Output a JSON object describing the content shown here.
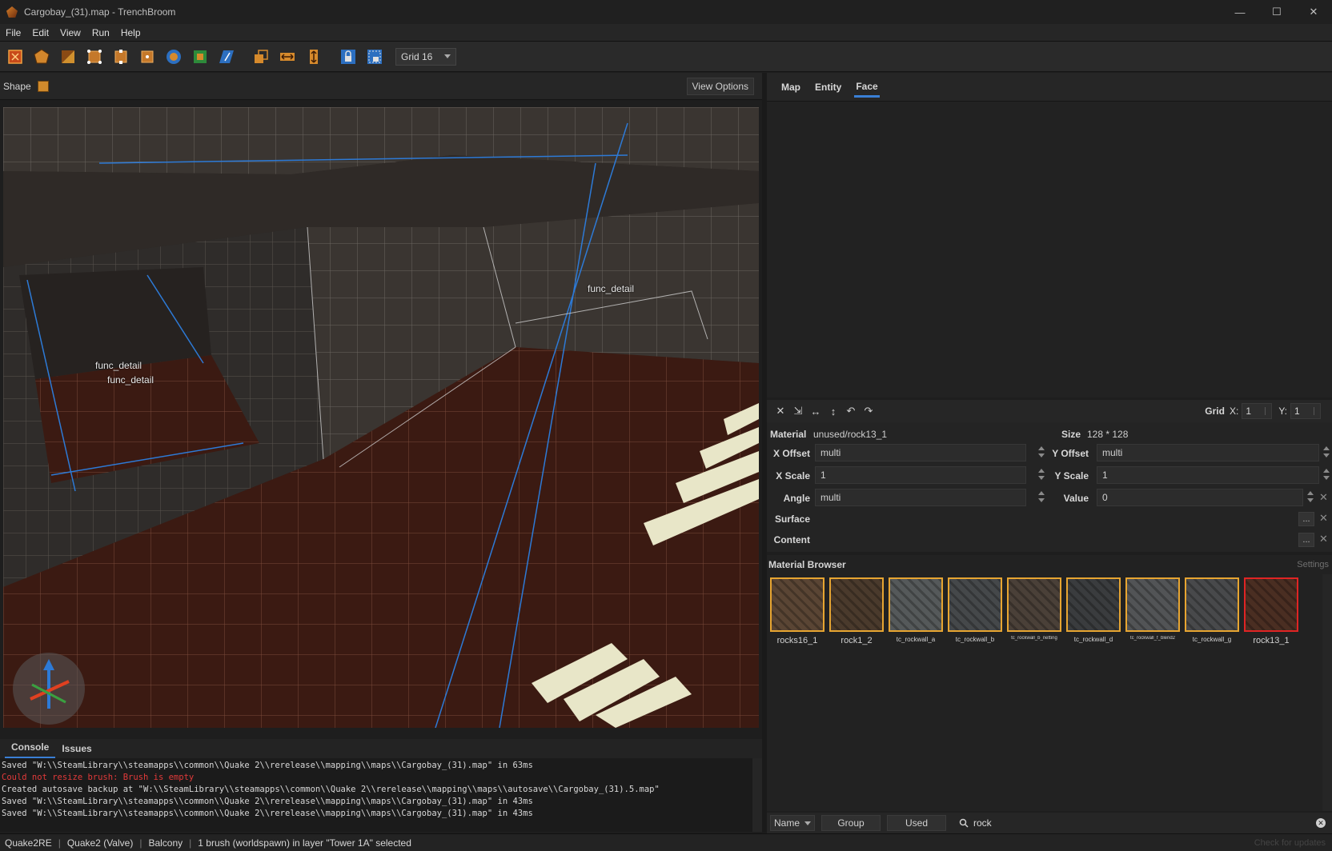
{
  "window": {
    "title": "Cargobay_(31).map - TrenchBroom"
  },
  "menu": [
    "File",
    "Edit",
    "View",
    "Run",
    "Help"
  ],
  "toolbar": {
    "grid_label": "Grid 16"
  },
  "left_header": {
    "shape_label": "Shape",
    "view_options": "View Options"
  },
  "viewport": {
    "labels": [
      "func_detail",
      "func_detail",
      "func_detail"
    ]
  },
  "console": {
    "tabs": [
      "Console",
      "Issues"
    ],
    "lines": [
      {
        "text": "Saved \"W:\\\\SteamLibrary\\\\steamapps\\\\common\\\\Quake 2\\\\rerelease\\\\mapping\\\\maps\\\\Cargobay_(31).map\" in 63ms",
        "error": false
      },
      {
        "text": "Could not resize brush: Brush is empty",
        "error": true
      },
      {
        "text": "Created autosave backup at \"W:\\\\SteamLibrary\\\\steamapps\\\\common\\\\Quake 2\\\\rerelease\\\\mapping\\\\maps\\\\autosave\\\\Cargobay_(31).5.map\"",
        "error": false
      },
      {
        "text": "Saved \"W:\\\\SteamLibrary\\\\steamapps\\\\common\\\\Quake 2\\\\rerelease\\\\mapping\\\\maps\\\\Cargobay_(31).map\" in 43ms",
        "error": false
      },
      {
        "text": "Saved \"W:\\\\SteamLibrary\\\\steamapps\\\\common\\\\Quake 2\\\\rerelease\\\\mapping\\\\maps\\\\Cargobay_(31).map\" in 43ms",
        "error": false
      }
    ]
  },
  "status": {
    "items": [
      "Quake2RE",
      "Quake2 (Valve)",
      "Balcony",
      "1 brush (worldspawn) in layer \"Tower 1A\" selected"
    ],
    "right_note": "Check for updates"
  },
  "inspector": {
    "tabs": [
      "Map",
      "Entity",
      "Face"
    ],
    "active_tab": "Face",
    "grid": {
      "label": "Grid",
      "x_label": "X:",
      "x": "1",
      "y_label": "Y:",
      "y": "1"
    }
  },
  "face": {
    "material_label": "Material",
    "material": "unused/rock13_1",
    "size_label": "Size",
    "size": "128 * 128",
    "x_offset_label": "X Offset",
    "x_offset": "multi",
    "y_offset_label": "Y Offset",
    "y_offset": "multi",
    "x_scale_label": "X Scale",
    "x_scale": "1",
    "y_scale_label": "Y Scale",
    "y_scale": "1",
    "angle_label": "Angle",
    "angle": "multi",
    "value_label": "Value",
    "value": "0",
    "surface_label": "Surface",
    "content_label": "Content"
  },
  "material_browser": {
    "title": "Material Browser",
    "settings": "Settings",
    "tiles": [
      {
        "name": "rocks16_1",
        "size": "normal",
        "selected": false,
        "color": "#5a4534"
      },
      {
        "name": "rock1_2",
        "size": "normal",
        "selected": false,
        "color": "#4a3a2c"
      },
      {
        "name": "tc_rockwall_a",
        "size": "small",
        "selected": false,
        "color": "#55595a"
      },
      {
        "name": "tc_rockwall_b",
        "size": "small",
        "selected": false,
        "color": "#45484a"
      },
      {
        "name": "tc_rockwall_b_netting",
        "size": "tiny",
        "selected": false,
        "color": "#4a4038"
      },
      {
        "name": "tc_rockwall_d",
        "size": "small",
        "selected": false,
        "color": "#3a3c3e"
      },
      {
        "name": "tc_rockwall_f_blend2",
        "size": "tiny",
        "selected": false,
        "color": "#525456"
      },
      {
        "name": "tc_rockwall_g",
        "size": "small",
        "selected": false,
        "color": "#48494b"
      },
      {
        "name": "rock13_1",
        "size": "normal",
        "selected": true,
        "color": "#4a2e22"
      }
    ],
    "sort_label": "Name",
    "group_label": "Group",
    "used_label": "Used",
    "filter": "rock"
  },
  "colors": {
    "accent": "#3a7fd5",
    "tile_border": "#e7a531",
    "selected_border": "#e02424",
    "error_text": "#e23a3a"
  }
}
